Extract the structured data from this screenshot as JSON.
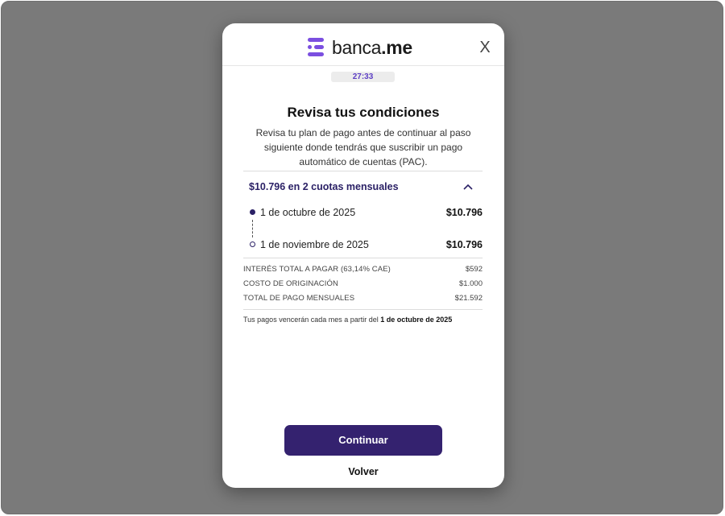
{
  "header": {
    "brand_prefix": "banca",
    "brand_suffix": ".me",
    "close_label": "X"
  },
  "timer": "27:33",
  "title": "Revisa tus condiciones",
  "subtitle": "Revisa tu plan de pago antes de continuar al paso siguiente donde tendrás que suscribir un pago automático de cuentas (PAC).",
  "plan": {
    "summary": "$10.796 en 2 cuotas mensuales",
    "installments": [
      {
        "date": "1 de octubre de 2025",
        "amount": "$10.796"
      },
      {
        "date": "1 de noviembre de 2025",
        "amount": "$10.796"
      }
    ]
  },
  "details": [
    {
      "label": "INTERÉS TOTAL A PAGAR (63,14% CAE)",
      "value": "$592"
    },
    {
      "label": "COSTO DE ORIGINACIÓN",
      "value": "$1.000"
    },
    {
      "label": "TOTAL DE PAGO MENSUALES",
      "value": "$21.592"
    }
  ],
  "note": {
    "prefix": "Tus pagos vencerán cada mes a partir del ",
    "date": "1 de octubre de 2025"
  },
  "actions": {
    "continue_label": "Continuar",
    "back_label": "Volver"
  },
  "colors": {
    "brand": "#7b4fe0",
    "primary_button": "#34226f",
    "accent_text": "#2b2166",
    "backdrop": "#7a7a7a"
  }
}
